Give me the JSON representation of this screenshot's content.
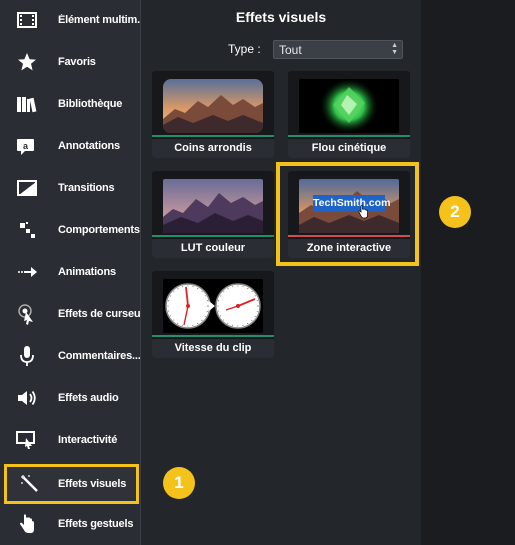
{
  "sidebar": {
    "items": [
      {
        "label": "Élément multim...",
        "icon": "film-strip-icon"
      },
      {
        "label": "Favoris",
        "icon": "star-icon"
      },
      {
        "label": "Bibliothèque",
        "icon": "library-books-icon"
      },
      {
        "label": "Annotations",
        "icon": "annotation-icon"
      },
      {
        "label": "Transitions",
        "icon": "transition-icon"
      },
      {
        "label": "Comportements",
        "icon": "behaviors-icon"
      },
      {
        "label": "Animations",
        "icon": "animation-arrow-icon"
      },
      {
        "label": "Effets de curseur",
        "icon": "cursor-effect-icon"
      },
      {
        "label": "Commentaires...",
        "icon": "microphone-icon"
      },
      {
        "label": "Effets audio",
        "icon": "speaker-icon"
      },
      {
        "label": "Interactivité",
        "icon": "interactivity-icon"
      },
      {
        "label": "Effets visuels",
        "icon": "magic-wand-icon"
      },
      {
        "label": "Effets gestuels",
        "icon": "hand-gesture-icon"
      }
    ]
  },
  "panel": {
    "title": "Effets visuels",
    "type_label": "Type :",
    "type_value": "Tout"
  },
  "tiles": [
    {
      "label": "Coins arrondis"
    },
    {
      "label": "Flou cinétique"
    },
    {
      "label": "LUT couleur"
    },
    {
      "label": "Zone interactive",
      "overlay_text": "TechSmith.com"
    },
    {
      "label": "Vitesse du clip"
    }
  ],
  "callouts": {
    "one": "1",
    "two": "2"
  },
  "colors": {
    "highlight": "#f5c21b",
    "accent_line": "#1f8f6e",
    "sidebar_bg": "#2a2d33"
  }
}
